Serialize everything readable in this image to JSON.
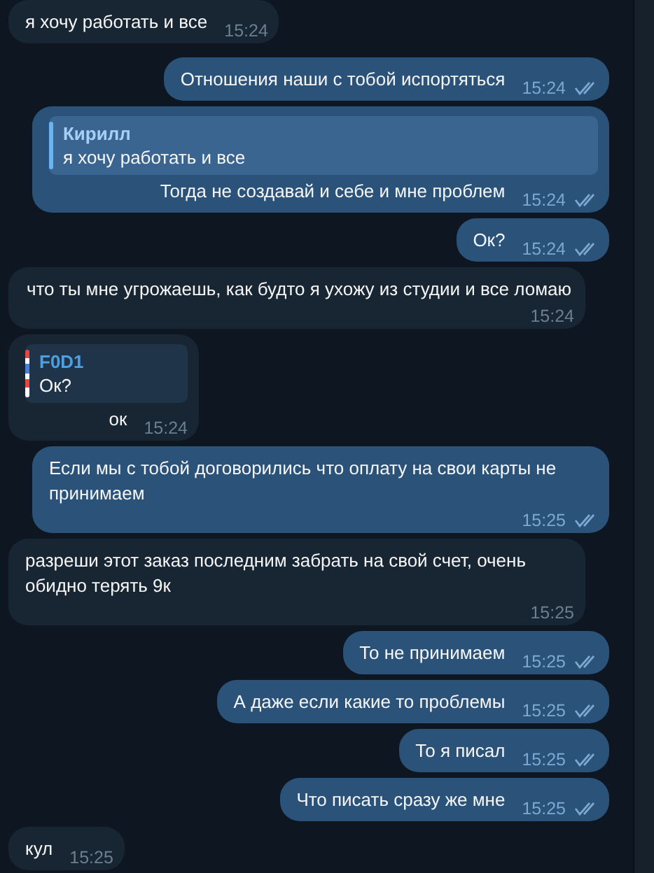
{
  "messages": [
    {
      "kind": "incoming",
      "text": "я хочу работать и все",
      "time": "15:24"
    },
    {
      "kind": "outgoing",
      "text": "Отношения наши с тобой испортяться",
      "time": "15:24",
      "read": true
    },
    {
      "kind": "outgoing",
      "text": "Тогда не создавай и себе и мне проблем",
      "time": "15:24",
      "read": true,
      "reply": {
        "author": "Кирилл",
        "text": "я хочу работать и все",
        "kind": "plain"
      }
    },
    {
      "kind": "outgoing",
      "text": "Ок?",
      "time": "15:24",
      "read": true
    },
    {
      "kind": "incoming",
      "text": "что ты мне угрожаешь, как будто я ухожу из студии и все ломаю",
      "time": "15:24"
    },
    {
      "kind": "incoming",
      "text": "ок",
      "time": "15:24",
      "reply": {
        "author": "F0D1",
        "text": "Ок?",
        "kind": "striped"
      }
    },
    {
      "kind": "outgoing",
      "text": "Если мы с тобой договорились что оплату на свои карты не принимаем",
      "time": "15:25",
      "read": true
    },
    {
      "kind": "incoming",
      "text": "разреши этот заказ последним забрать на свой счет, очень обидно терять 9к",
      "time": "15:25"
    },
    {
      "kind": "outgoing",
      "text": "То не принимаем",
      "time": "15:25",
      "read": true
    },
    {
      "kind": "outgoing",
      "text": "А даже если какие то проблемы",
      "time": "15:25",
      "read": true
    },
    {
      "kind": "outgoing",
      "text": "То я писал",
      "time": "15:25",
      "read": true
    },
    {
      "kind": "outgoing",
      "text": "Что писать сразу же мне",
      "time": "15:25",
      "read": true
    },
    {
      "kind": "incoming",
      "text": "кул",
      "time": "15:25"
    }
  ]
}
